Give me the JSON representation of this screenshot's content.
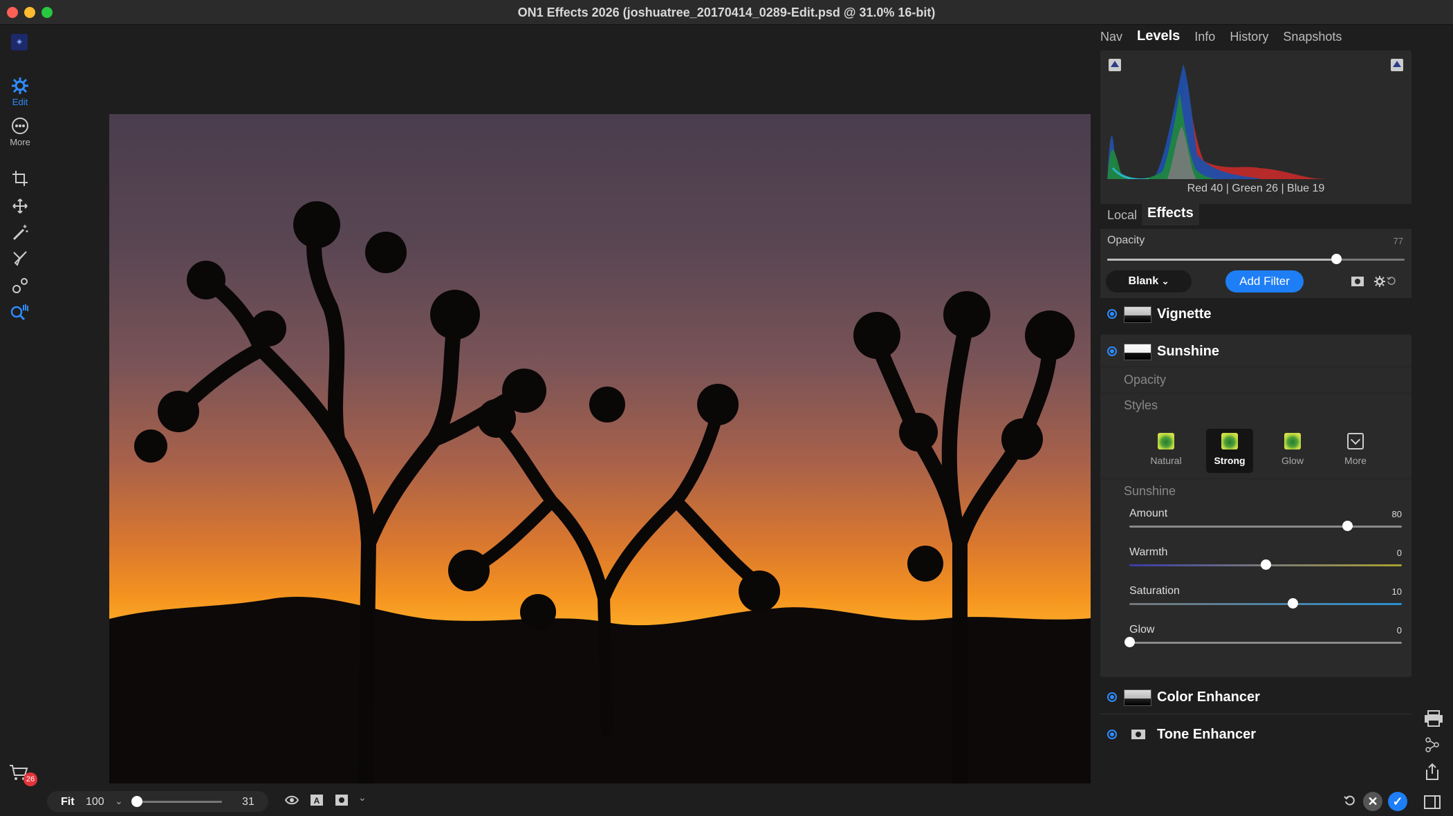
{
  "window": {
    "title": "ON1 Effects 2026 (joshuatree_20170414_0289-Edit.psd @ 31.0% 16-bit)"
  },
  "left_toolbar": {
    "edit_label": "Edit",
    "more_label": "More",
    "cart_badge": "26"
  },
  "bottom_bar": {
    "fit_label": "Fit",
    "zoom_value": "100",
    "zoom_percent": "31",
    "zoom_slider_level": 0.0
  },
  "right_panel": {
    "top_tabs": [
      "Nav",
      "Levels",
      "Info",
      "History",
      "Snapshots"
    ],
    "active_top_tab": "Levels",
    "histogram_readout": "Red  40  | Green  26  | Blue  19",
    "sub_tabs": [
      "Local",
      "Effects"
    ],
    "active_sub_tab": "Effects",
    "layer_opacity": {
      "label": "Opacity",
      "value": "77",
      "level": 0.77
    },
    "blank_dropdown": "Blank",
    "add_filter_label": "Add Filter",
    "filters": [
      {
        "name": "Vignette"
      },
      {
        "name": "Sunshine"
      },
      {
        "name": "Color Enhancer"
      },
      {
        "name": "Tone Enhancer"
      }
    ],
    "sunshine": {
      "opacity_label": "Opacity",
      "styles_label": "Styles",
      "styles": [
        "Natural",
        "Strong",
        "Glow",
        "More"
      ],
      "selected_style": "Strong",
      "section_label": "Sunshine",
      "sliders": [
        {
          "label": "Amount",
          "value": "80",
          "level": 0.8
        },
        {
          "label": "Warmth",
          "value": "0",
          "level": 0.5
        },
        {
          "label": "Saturation",
          "value": "10",
          "level": 0.6
        },
        {
          "label": "Glow",
          "value": "0",
          "level": 0.0
        }
      ]
    }
  },
  "colors": {
    "accent": "#1e7ef5",
    "panel": "#2a2a2a",
    "background": "#1e1e1e",
    "cancel": "#555555",
    "badge": "#e2343a"
  }
}
